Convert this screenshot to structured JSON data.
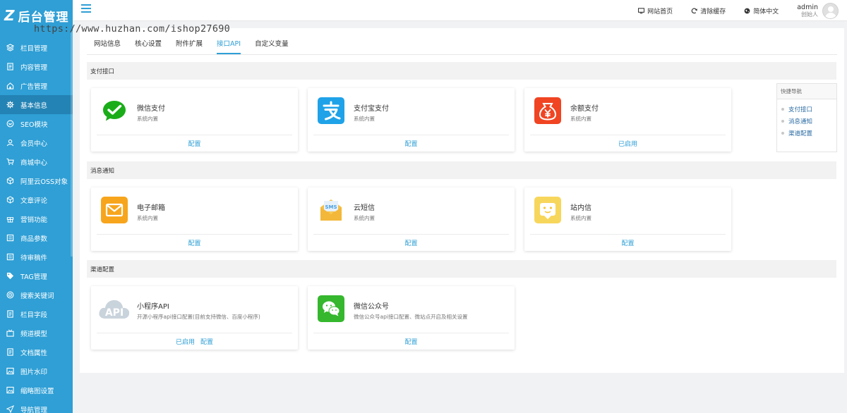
{
  "app": {
    "logo_text": "后台管理"
  },
  "watermark": "https://www.huzhan.com/ishop27690",
  "sidebar": {
    "items": [
      {
        "label": "栏目管理",
        "icon": "layers-icon"
      },
      {
        "label": "内容管理",
        "icon": "document-icon"
      },
      {
        "label": "广告管理",
        "icon": "home-icon"
      },
      {
        "label": "基本信息",
        "icon": "gear-icon",
        "active": true
      },
      {
        "label": "SEO模块",
        "icon": "seo-icon"
      },
      {
        "label": "会员中心",
        "icon": "user-icon"
      },
      {
        "label": "商城中心",
        "icon": "cart-icon"
      },
      {
        "label": "阿里云OSS对象",
        "icon": "cube-icon"
      },
      {
        "label": "文章评论",
        "icon": "cube-icon"
      },
      {
        "label": "营销功能",
        "icon": "gift-icon"
      },
      {
        "label": "商品参数",
        "icon": "list-icon"
      },
      {
        "label": "待审稿件",
        "icon": "list-icon"
      },
      {
        "label": "TAG管理",
        "icon": "tag-icon"
      },
      {
        "label": "搜索关键词",
        "icon": "target-icon"
      },
      {
        "label": "栏目字段",
        "icon": "document-icon"
      },
      {
        "label": "频道模型",
        "icon": "tv-icon"
      },
      {
        "label": "文档属性",
        "icon": "document-icon"
      },
      {
        "label": "图片水印",
        "icon": "image-icon"
      },
      {
        "label": "缩略图设置",
        "icon": "image-icon"
      },
      {
        "label": "导航管理",
        "icon": "send-icon"
      }
    ]
  },
  "topbar": {
    "links": [
      {
        "label": "网站首页",
        "icon": "monitor-icon"
      },
      {
        "label": "清除缓存",
        "icon": "refresh-icon"
      },
      {
        "label": "简体中文",
        "icon": "globe-icon"
      }
    ],
    "user": {
      "name": "admin",
      "role": "创始人"
    }
  },
  "tabs": [
    {
      "label": "网站信息"
    },
    {
      "label": "核心设置"
    },
    {
      "label": "附件扩展"
    },
    {
      "label": "接口API",
      "active": true
    },
    {
      "label": "自定义变量"
    }
  ],
  "sections": {
    "payment": {
      "title": "支付接口",
      "cards": [
        {
          "title": "微信支付",
          "subtitle": "系统内置",
          "icon": "wechat-pay-icon",
          "links": [
            "配置"
          ]
        },
        {
          "title": "支付宝支付",
          "subtitle": "系统内置",
          "icon": "alipay-icon",
          "links": [
            "配置"
          ]
        },
        {
          "title": "余额支付",
          "subtitle": "系统内置",
          "icon": "balance-icon",
          "links": [
            "已启用"
          ]
        }
      ]
    },
    "message": {
      "title": "消息通知",
      "cards": [
        {
          "title": "电子邮箱",
          "subtitle": "系统内置",
          "icon": "email-icon",
          "links": [
            "配置"
          ]
        },
        {
          "title": "云短信",
          "subtitle": "系统内置",
          "icon": "sms-icon",
          "links": [
            "配置"
          ]
        },
        {
          "title": "站内信",
          "subtitle": "系统内置",
          "icon": "site-message-icon",
          "links": [
            "配置"
          ]
        }
      ]
    },
    "channel": {
      "title": "渠道配置",
      "cards": [
        {
          "title": "小程序API",
          "subtitle": "开源小程序api接口配置(目前支持微信、百度小程序)",
          "icon": "api-cloud-icon",
          "links": [
            "已启用",
            "配置"
          ]
        },
        {
          "title": "微信公众号",
          "subtitle": "微信公众号api接口配置、微站点开启及相关设置",
          "icon": "wechat-official-icon",
          "links": [
            "配置"
          ]
        }
      ]
    }
  },
  "quick_nav": {
    "title": "快捷导航",
    "items": [
      "支付接口",
      "消息通知",
      "渠道配置"
    ]
  },
  "colors": {
    "sidebar": "#2f9fd5",
    "sidebar_active": "#2383b4",
    "accent": "#2f9fd5",
    "wechat_green": "#1aad19",
    "alipay_blue": "#1fa2e8",
    "balance_red": "#f04422",
    "email_orange": "#f7a51c",
    "site_msg_yellow": "#f7d65c"
  }
}
